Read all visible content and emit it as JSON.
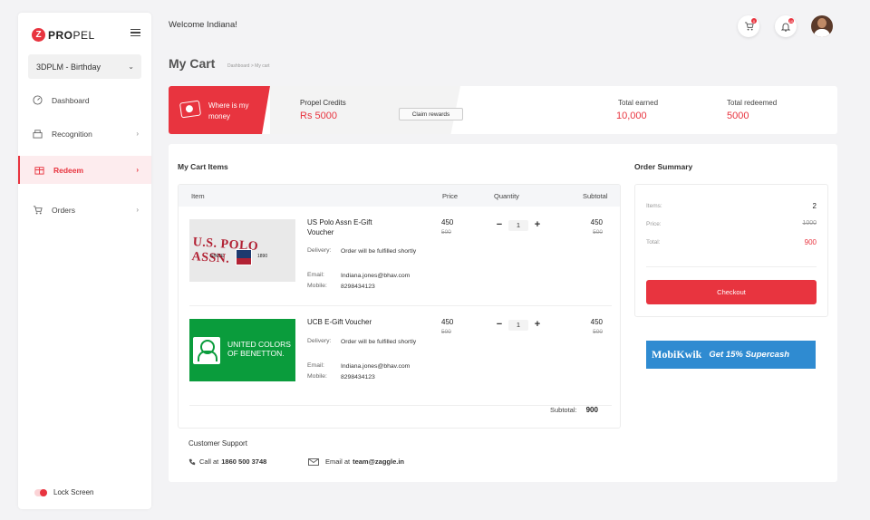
{
  "sidebar": {
    "logo_mark": "Z",
    "logo_bold": "PRO",
    "logo_thin": "PEL",
    "program": "3DPLM - Birthday",
    "items": [
      {
        "label": "Dashboard",
        "icon": "dashboard-icon"
      },
      {
        "label": "Recognition",
        "icon": "recognition-icon"
      },
      {
        "label": "Redeem",
        "icon": "redeem-icon"
      },
      {
        "label": "Orders",
        "icon": "cart-icon"
      }
    ],
    "lock_label": "Lock Screen"
  },
  "header": {
    "welcome": "Welcome Indiana!",
    "cart_badge": "0",
    "bell_badge": "10"
  },
  "page": {
    "title": "My Cart",
    "breadcrumb": "Dashboard > My cart"
  },
  "banner": {
    "where_text": "Where is my money",
    "credits_label": "Propel Credits",
    "credits_value": "Rs 5000",
    "claim_label": "Claim rewards",
    "earned_label": "Total earned",
    "earned_value": "10,000",
    "redeemed_label": "Total redeemed",
    "redeemed_value": "5000"
  },
  "cart": {
    "title": "My Cart Items",
    "columns": {
      "item": "Item",
      "price": "Price",
      "quantity": "Quantity",
      "subtotal": "Subtotal"
    },
    "delivery_label": "Delivery:",
    "email_label": "Email:",
    "mobile_label": "Mobile:",
    "items": [
      {
        "name": "US Polo Assn E-Gift Voucher",
        "brand_text": "U.S. POLO ASSN.",
        "since": "SINCE",
        "year": "1890",
        "delivery": "Order will be fulfilled shortly",
        "email": "Indiana.jones@bhav.com",
        "mobile": "8298434123",
        "price": "450",
        "old_price": "500",
        "qty": "1",
        "subtotal": "450",
        "old_subtotal": "500"
      },
      {
        "name": "UCB E-Gift Voucher",
        "brand_text": "UNITED COLORS OF BENETTON.",
        "delivery": "Order will be fulfilled shortly",
        "email": "Indiana.jones@bhav.com",
        "mobile": "8298434123",
        "price": "450",
        "old_price": "500",
        "qty": "1",
        "subtotal": "450",
        "old_subtotal": "500"
      }
    ],
    "subtotal_label": "Subtotal:",
    "subtotal_value": "900"
  },
  "support": {
    "title": "Customer Support",
    "call_prefix": "Call at",
    "phone": "1860 500 3748",
    "email_prefix": "Email at",
    "email": "team@zaggle.in"
  },
  "summary": {
    "title": "Order Summary",
    "items_label": "Items:",
    "items_value": "2",
    "price_label": "Price:",
    "price_value": "1000",
    "total_label": "Total:",
    "total_value": "900",
    "checkout_label": "Checkout"
  },
  "promo": {
    "brand": "MobiKwik",
    "text": "Get 15% Supercash"
  },
  "colors": {
    "accent": "#e8343f",
    "promo": "#2f8bd1"
  }
}
